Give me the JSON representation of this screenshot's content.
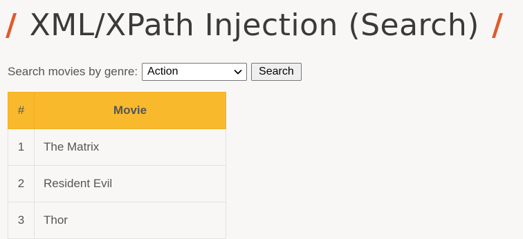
{
  "page": {
    "title": "XML/XPath Injection (Search)",
    "title_slash": "/",
    "accent_color": "#e25a2a"
  },
  "search": {
    "label": "Search movies by genre:",
    "selected_genre": "Action",
    "button_label": "Search"
  },
  "table": {
    "header_color": "#f8b92d",
    "columns": [
      "#",
      "Movie"
    ],
    "rows": [
      {
        "num": "1",
        "movie": "The Matrix"
      },
      {
        "num": "2",
        "movie": "Resident Evil"
      },
      {
        "num": "3",
        "movie": "Thor"
      }
    ]
  }
}
